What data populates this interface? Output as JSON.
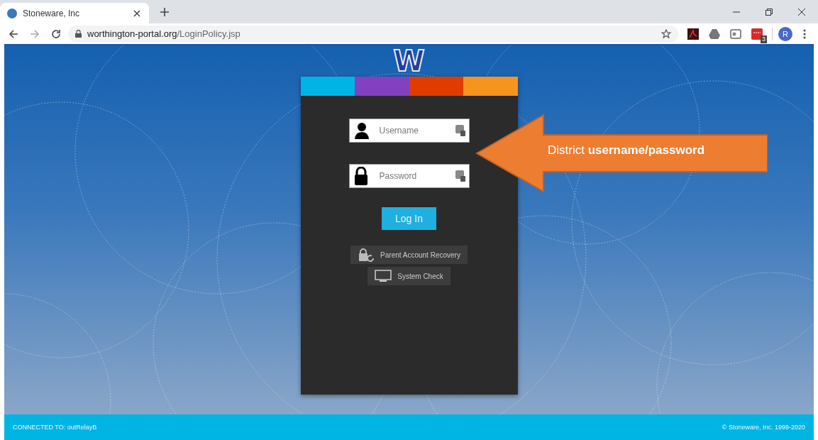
{
  "browser": {
    "tab": {
      "title": "Stoneware, Inc"
    },
    "url": {
      "host": "worthington-portal.org",
      "path": "/LoginPolicy.jsp"
    },
    "extension_badge": "3",
    "profile_initial": "R"
  },
  "page": {
    "logo_letter": "W",
    "stripes": [
      {
        "color": "#00b4e6"
      },
      {
        "color": "#8340c0"
      },
      {
        "color": "#e03c00"
      },
      {
        "color": "#f7941d"
      }
    ],
    "fields": [
      {
        "kind": "user",
        "placeholder": "Username"
      },
      {
        "kind": "lock",
        "placeholder": "Password"
      }
    ],
    "login_button": "Log In",
    "links": [
      {
        "kind": "recovery",
        "label": "Parent Account Recovery"
      },
      {
        "kind": "monitor",
        "label": "System Check"
      }
    ],
    "callout": "District **username/password**"
  },
  "footer": {
    "connection": "CONNECTED TO: outRelayB",
    "copyright": "© Stoneware, Inc. 1999-2020"
  }
}
